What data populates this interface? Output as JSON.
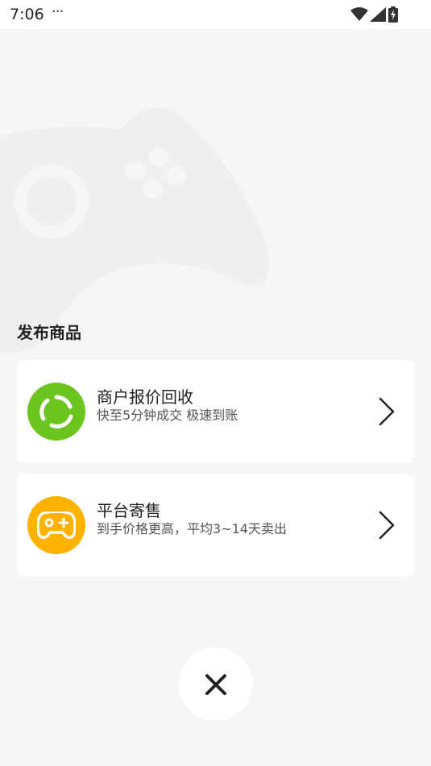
{
  "status_bar": {
    "time": "7:06",
    "more": "···",
    "icons": [
      "wifi-icon",
      "signal-icon",
      "battery-charging-icon"
    ]
  },
  "section": {
    "title": "发布商品"
  },
  "cards": [
    {
      "title": "商户报价回收",
      "subtitle": "快至5分钟成交 极速到账",
      "icon": "recycle-icon",
      "icon_color": "#6cc51f"
    },
    {
      "title": "平台寄售",
      "subtitle": "到手价格更高，平均3~14天卖出",
      "icon": "gamepad-icon",
      "icon_color": "#ffb300"
    }
  ],
  "close": {
    "icon": "close-icon"
  },
  "colors": {
    "background": "#f6f6f6",
    "card": "#ffffff",
    "text_primary": "#222222",
    "text_secondary": "#555555",
    "green": "#6cc51f",
    "yellow": "#ffb300"
  }
}
